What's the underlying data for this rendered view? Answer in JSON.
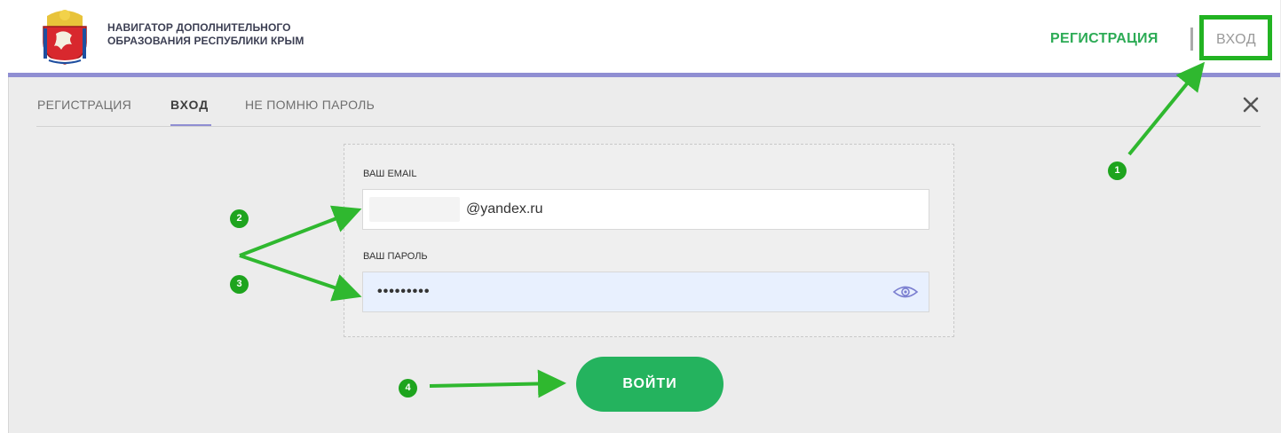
{
  "header": {
    "title_line1": "НАВИГАТОР ДОПОЛНИТЕЛЬНОГО",
    "title_line2": "ОБРАЗОВАНИЯ РЕСПУБЛИКИ КРЫМ",
    "register_label": "РЕГИСТРАЦИЯ",
    "login_label": "ВХОД",
    "accent_color": "#8f8ed2",
    "brand_green": "#2cab55"
  },
  "tabs": [
    {
      "label": "РЕГИСТРАЦИЯ",
      "active": false
    },
    {
      "label": "ВХОД",
      "active": true
    },
    {
      "label": "НЕ ПОМНЮ ПАРОЛЬ",
      "active": false
    }
  ],
  "form": {
    "email_label": "ВАШ EMAIL",
    "email_value": "@yandex.ru",
    "password_label": "ВАШ ПАРОЛЬ",
    "password_value": "•••••••••",
    "submit_label": "ВОЙТИ",
    "submit_color": "#24b35e"
  },
  "annotations": {
    "badges": [
      "1",
      "2",
      "3",
      "4"
    ],
    "color": "#1ea41e"
  },
  "icons": {
    "close": "close-icon",
    "eye": "eye-icon",
    "logo": "coat-of-arms-logo"
  }
}
